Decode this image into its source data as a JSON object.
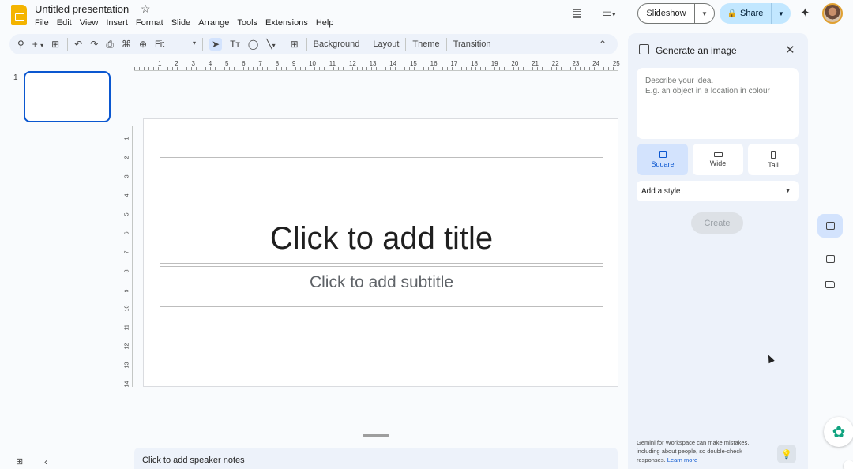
{
  "header": {
    "doc_title": "Untitled presentation",
    "menu": [
      "File",
      "Edit",
      "View",
      "Insert",
      "Format",
      "Slide",
      "Arrange",
      "Tools",
      "Extensions",
      "Help"
    ],
    "slideshow_label": "Slideshow",
    "share_label": "Share"
  },
  "toolbar": {
    "zoom_label": "Fit",
    "background_label": "Background",
    "layout_label": "Layout",
    "theme_label": "Theme",
    "transition_label": "Transition"
  },
  "filmstrip": {
    "slide_number": "1"
  },
  "ruler": {
    "horizontal": [
      "1",
      "2",
      "3",
      "4",
      "5",
      "6",
      "7",
      "8",
      "9",
      "10",
      "11",
      "12",
      "13",
      "14",
      "15",
      "16",
      "17",
      "18",
      "19",
      "20",
      "21",
      "22",
      "23",
      "24",
      "25"
    ],
    "vertical": [
      "1",
      "2",
      "3",
      "4",
      "5",
      "6",
      "7",
      "8",
      "9",
      "10",
      "11",
      "12",
      "13",
      "14"
    ]
  },
  "slide": {
    "title_placeholder": "Click to add title",
    "subtitle_placeholder": "Click to add subtitle"
  },
  "notes": {
    "placeholder": "Click to add speaker notes"
  },
  "panel": {
    "title": "Generate an image",
    "prompt_line1": "Describe your idea.",
    "prompt_line2": "E.g. an object in a location in colour",
    "aspect_square": "Square",
    "aspect_wide": "Wide",
    "aspect_tall": "Tall",
    "style_label": "Add a style",
    "create_label": "Create",
    "disclaimer": "Gemini for Workspace can make mistakes, including about people, so double-check responses.",
    "learn_more": "Learn more"
  },
  "colors": {
    "accent": "#0b57d0",
    "share_bg": "#c2e7ff",
    "selected_aspect_bg": "#d3e3fd",
    "logo": "#f4b400"
  }
}
